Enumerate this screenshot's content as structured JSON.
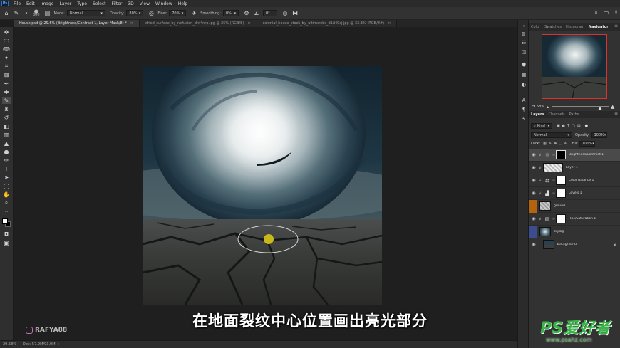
{
  "menubar": {
    "app_icon": "Ps",
    "items": [
      "File",
      "Edit",
      "Image",
      "Layer",
      "Type",
      "Select",
      "Filter",
      "3D",
      "View",
      "Window",
      "Help"
    ]
  },
  "options": {
    "brush_size": "300",
    "mode_label": "Mode:",
    "mode_value": "Normal",
    "opacity_label": "Opacity:",
    "opacity_value": "80%",
    "flow_label": "Flow:",
    "flow_value": "70%",
    "smoothing_label": "Smoothing:",
    "smoothing_value": "0%",
    "angle_value": "0°"
  },
  "tabs": [
    {
      "label": "House.psd @ 29.6% (Brightness/Contrast 1, Layer Mask/8) *",
      "active": true
    },
    {
      "label": "dried_surface_by_nefusion_dhf4nrp.jpg @ 25% (RGB/8)",
      "active": false
    },
    {
      "label": "colonial_house_stock_by_ultimwebs_d1d49sj.jpg @ 33.3% (RGB/8#)",
      "active": false
    }
  ],
  "status": {
    "zoom": "29.58%",
    "doc": "Doc: 57.9M/93.0M"
  },
  "navigator": {
    "tabs": [
      "Color",
      "Swatches",
      "Histogram",
      "Navigator"
    ],
    "active_tab": "Navigator",
    "zoom": "29.58%"
  },
  "layers_panel": {
    "tabs": [
      "Layers",
      "Channels",
      "Paths"
    ],
    "active_tab": "Layers",
    "kind_label": "Kind",
    "blend_mode": "Normal",
    "opacity_label": "Opacity:",
    "opacity_value": "100%",
    "lock_label": "Lock:",
    "fill_label": "Fill:",
    "fill_value": "100%",
    "layers": [
      {
        "name": "Brightness/Contrast 1",
        "type": "adjustment",
        "selected": true,
        "clipped": true,
        "mask": "black"
      },
      {
        "name": "Layer 1",
        "type": "pixel",
        "selected": false,
        "clipped": true
      },
      {
        "name": "Color Balance 1",
        "type": "adjustment",
        "selected": false,
        "clipped": true,
        "mask": "white"
      },
      {
        "name": "Levels 1",
        "type": "adjustment",
        "selected": false,
        "clipped": true,
        "mask": "white"
      },
      {
        "name": "ground",
        "type": "pixel",
        "selected": false,
        "clipped": false,
        "color_tag": "#b5620f"
      },
      {
        "name": "Hue/Saturation 1",
        "type": "adjustment",
        "selected": false,
        "clipped": true,
        "mask": "white"
      },
      {
        "name": "sky.bg",
        "type": "pixel",
        "selected": false,
        "clipped": false,
        "color_tag": "#3b4d8f"
      },
      {
        "name": "Background",
        "type": "background",
        "selected": false,
        "clipped": false,
        "locked": true
      }
    ]
  },
  "caption": "在地面裂纹中心位置画出亮光部分",
  "watermark_left": "RAFYA88",
  "watermark_right": {
    "line1": "PS爱好者",
    "line2": "www.psahz.com"
  },
  "colors": {
    "accent_navigator_border": "#e0302a",
    "brush_dot": "#c9b81a",
    "ground_tag": "#b5620f",
    "sky_tag": "#3b4d8f"
  }
}
